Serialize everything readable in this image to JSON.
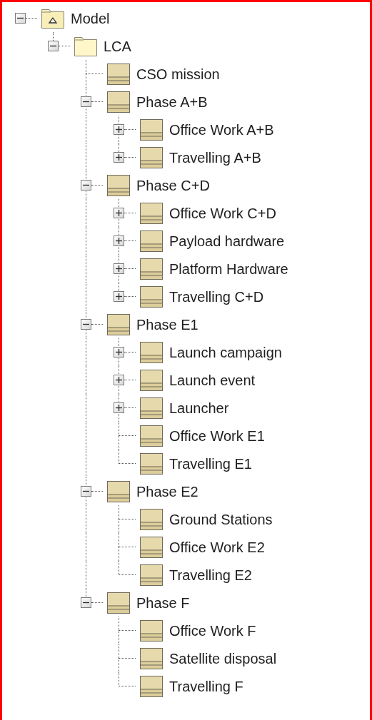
{
  "tree": [
    {
      "label": "Model",
      "kind": "model",
      "expanded": true,
      "children": [
        {
          "label": "LCA",
          "kind": "folder",
          "expanded": true,
          "children": [
            {
              "label": "CSO mission",
              "kind": "element"
            },
            {
              "label": "Phase A+B",
              "kind": "element",
              "expanded": true,
              "children": [
                {
                  "label": "Office Work A+B",
                  "kind": "element",
                  "expanded": false
                },
                {
                  "label": "Travelling A+B",
                  "kind": "element",
                  "expanded": false
                }
              ]
            },
            {
              "label": "Phase C+D",
              "kind": "element",
              "expanded": true,
              "children": [
                {
                  "label": "Office Work C+D",
                  "kind": "element",
                  "expanded": false
                },
                {
                  "label": "Payload hardware",
                  "kind": "element",
                  "expanded": false
                },
                {
                  "label": "Platform Hardware",
                  "kind": "element",
                  "expanded": false
                },
                {
                  "label": "Travelling C+D",
                  "kind": "element",
                  "expanded": false
                }
              ]
            },
            {
              "label": "Phase E1",
              "kind": "element",
              "expanded": true,
              "children": [
                {
                  "label": "Launch campaign",
                  "kind": "element",
                  "expanded": false
                },
                {
                  "label": "Launch event",
                  "kind": "element",
                  "expanded": false
                },
                {
                  "label": "Launcher",
                  "kind": "element",
                  "expanded": false
                },
                {
                  "label": "Office Work E1",
                  "kind": "element"
                },
                {
                  "label": "Travelling E1",
                  "kind": "element"
                }
              ]
            },
            {
              "label": "Phase E2",
              "kind": "element",
              "expanded": true,
              "children": [
                {
                  "label": "Ground Stations",
                  "kind": "element"
                },
                {
                  "label": "Office Work E2",
                  "kind": "element"
                },
                {
                  "label": "Travelling E2",
                  "kind": "element"
                }
              ]
            },
            {
              "label": "Phase F",
              "kind": "element",
              "expanded": true,
              "children": [
                {
                  "label": "Office Work F",
                  "kind": "element"
                },
                {
                  "label": "Satellite disposal",
                  "kind": "element"
                },
                {
                  "label": "Travelling F",
                  "kind": "element"
                }
              ]
            }
          ]
        }
      ]
    }
  ]
}
